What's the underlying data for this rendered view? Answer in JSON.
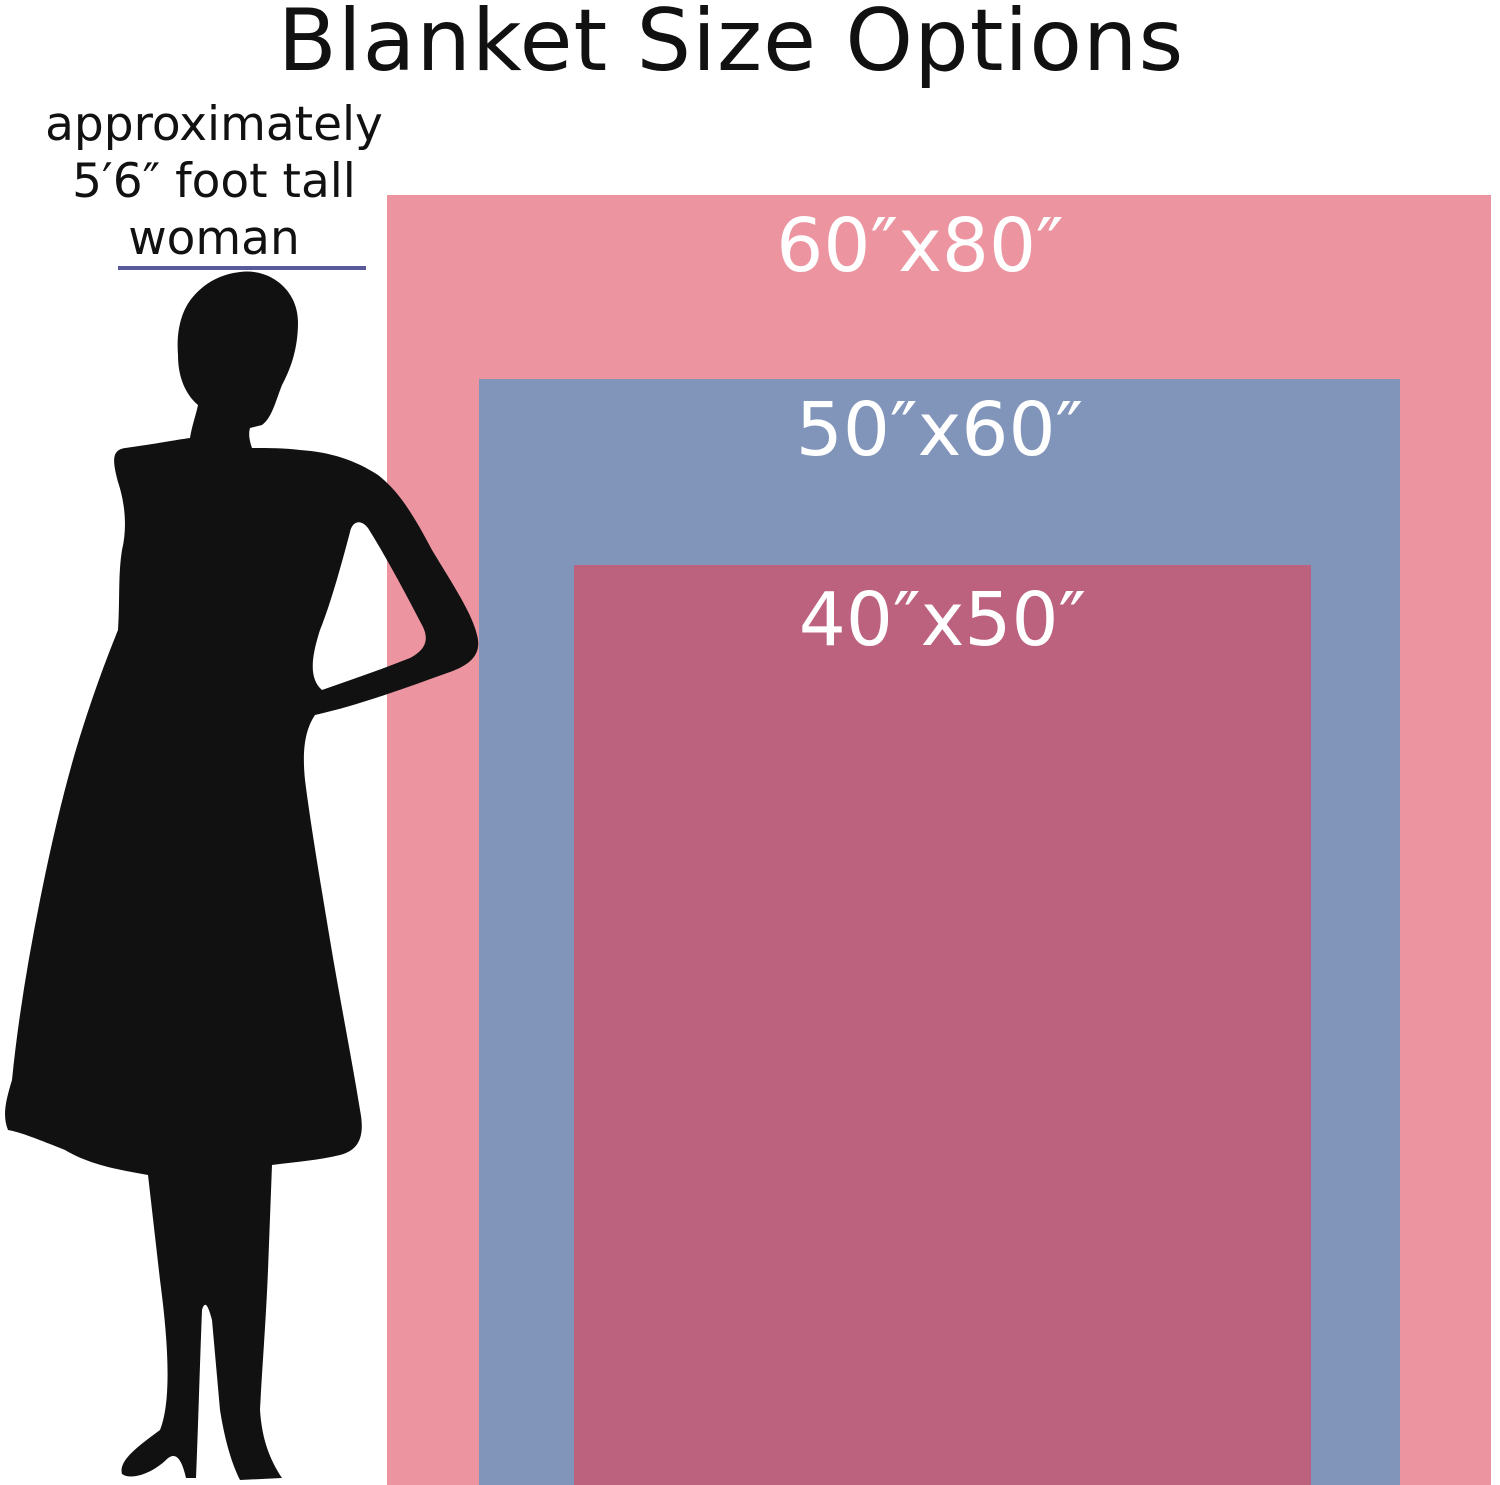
{
  "title": "Blanket Size Options",
  "person": {
    "label_lines": [
      "approximately",
      "5′6″ foot tall",
      "woman"
    ]
  },
  "blankets": [
    {
      "label": "60″x80″",
      "color": "#ec95a0"
    },
    {
      "label": "50″x60″",
      "color": "#8195ba"
    },
    {
      "label": "40″x50″",
      "color": "#bd627e"
    }
  ],
  "colors": {
    "background": "#ffffff",
    "text": "#111111",
    "silhouette": "#111111",
    "height_marker": "#5a5a9a"
  }
}
